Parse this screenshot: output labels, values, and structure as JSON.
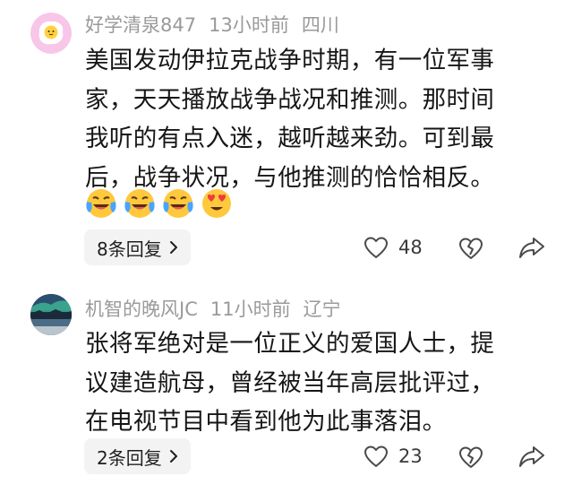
{
  "comments": [
    {
      "username": "好学清泉847",
      "time": "13小时前",
      "location": "四川",
      "text": "美国发动伊拉克战争时期，有一位军事\n家，天天播放战争战况和推测。那时间\n我听的有点入迷，越听越来劲。可到最\n后，战争状况，与他推测的恰恰相反。",
      "emojis": [
        "laughing-crying-emoji",
        "laughing-crying-emoji",
        "laughing-crying-emoji",
        "heart-eyes-emoji"
      ],
      "replies_label": "8条回复",
      "likes": "48"
    },
    {
      "username": "机智的晚风JC",
      "time": "11小时前",
      "location": "辽宁",
      "text": "张将军绝对是一位正义的爱国人士，提\n议建造航母，曾经被当年高层批评过，\n在电视节目中看到他为此事落泪。",
      "replies_label": "2条回复",
      "likes": "23"
    }
  ],
  "colors": {
    "meta_text": "#9a9a9a",
    "body_text": "#161616",
    "reply_pill_bg": "#f3f3f3",
    "icon_stroke": "#4a4a4a"
  }
}
